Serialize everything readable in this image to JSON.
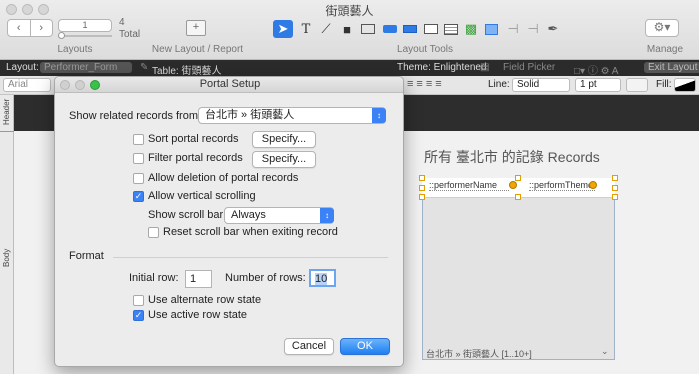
{
  "window": {
    "title": "街頭藝人"
  },
  "toolbar": {
    "record_current": "1",
    "record_total": "4",
    "record_total_label": "Total",
    "layouts_label": "Layouts",
    "new_layout_label": "New Layout / Report",
    "layout_tools_label": "Layout Tools",
    "manage_label": "Manage"
  },
  "layout_bar": {
    "layout_label": "Layout:",
    "layout_value": "Performer_Form",
    "table_label": "Table: 街頭藝人",
    "theme_label": "Theme: Enlightened",
    "field_picker": "Field Picker",
    "exit_layout": "Exit Layout"
  },
  "format_bar": {
    "font": "Arial",
    "line_label": "Line:",
    "line_style": "Solid",
    "line_width": "1 pt",
    "fill_label": "Fill:"
  },
  "parts": {
    "header": "Header",
    "body": "Body"
  },
  "canvas": {
    "records_title": "所有 臺北市 的記錄 Records",
    "field_performer_name": "::performerName",
    "field_perform_theme": "::performTheme",
    "portal_footer": "台北市 » 街頭藝人 [1..10+]"
  },
  "dialog": {
    "title": "Portal Setup",
    "show_related_label": "Show related records from:",
    "show_related_value": "台北市 » 街頭藝人",
    "sort_label": "Sort portal records",
    "sort_checked": false,
    "filter_label": "Filter portal records",
    "filter_checked": false,
    "specify_label": "Specify...",
    "allow_deletion_label": "Allow deletion of portal records",
    "allow_deletion_checked": false,
    "allow_scroll_label": "Allow vertical scrolling",
    "allow_scroll_checked": true,
    "show_scroll_bar_label": "Show scroll bar:",
    "show_scroll_bar_value": "Always",
    "reset_scroll_label": "Reset scroll bar when exiting record",
    "reset_scroll_checked": false,
    "format_label": "Format",
    "initial_row_label": "Initial row:",
    "initial_row_value": "1",
    "number_rows_label": "Number of rows:",
    "number_rows_value": "10",
    "alternate_row_label": "Use alternate row state",
    "alternate_row_checked": false,
    "active_row_label": "Use active row state",
    "active_row_checked": true,
    "cancel_label": "Cancel",
    "ok_label": "OK"
  },
  "colors": {
    "accent": "#3b82f6",
    "layout_bar_bg": "#2b2b2b",
    "portal_handle": "#f0a500"
  }
}
